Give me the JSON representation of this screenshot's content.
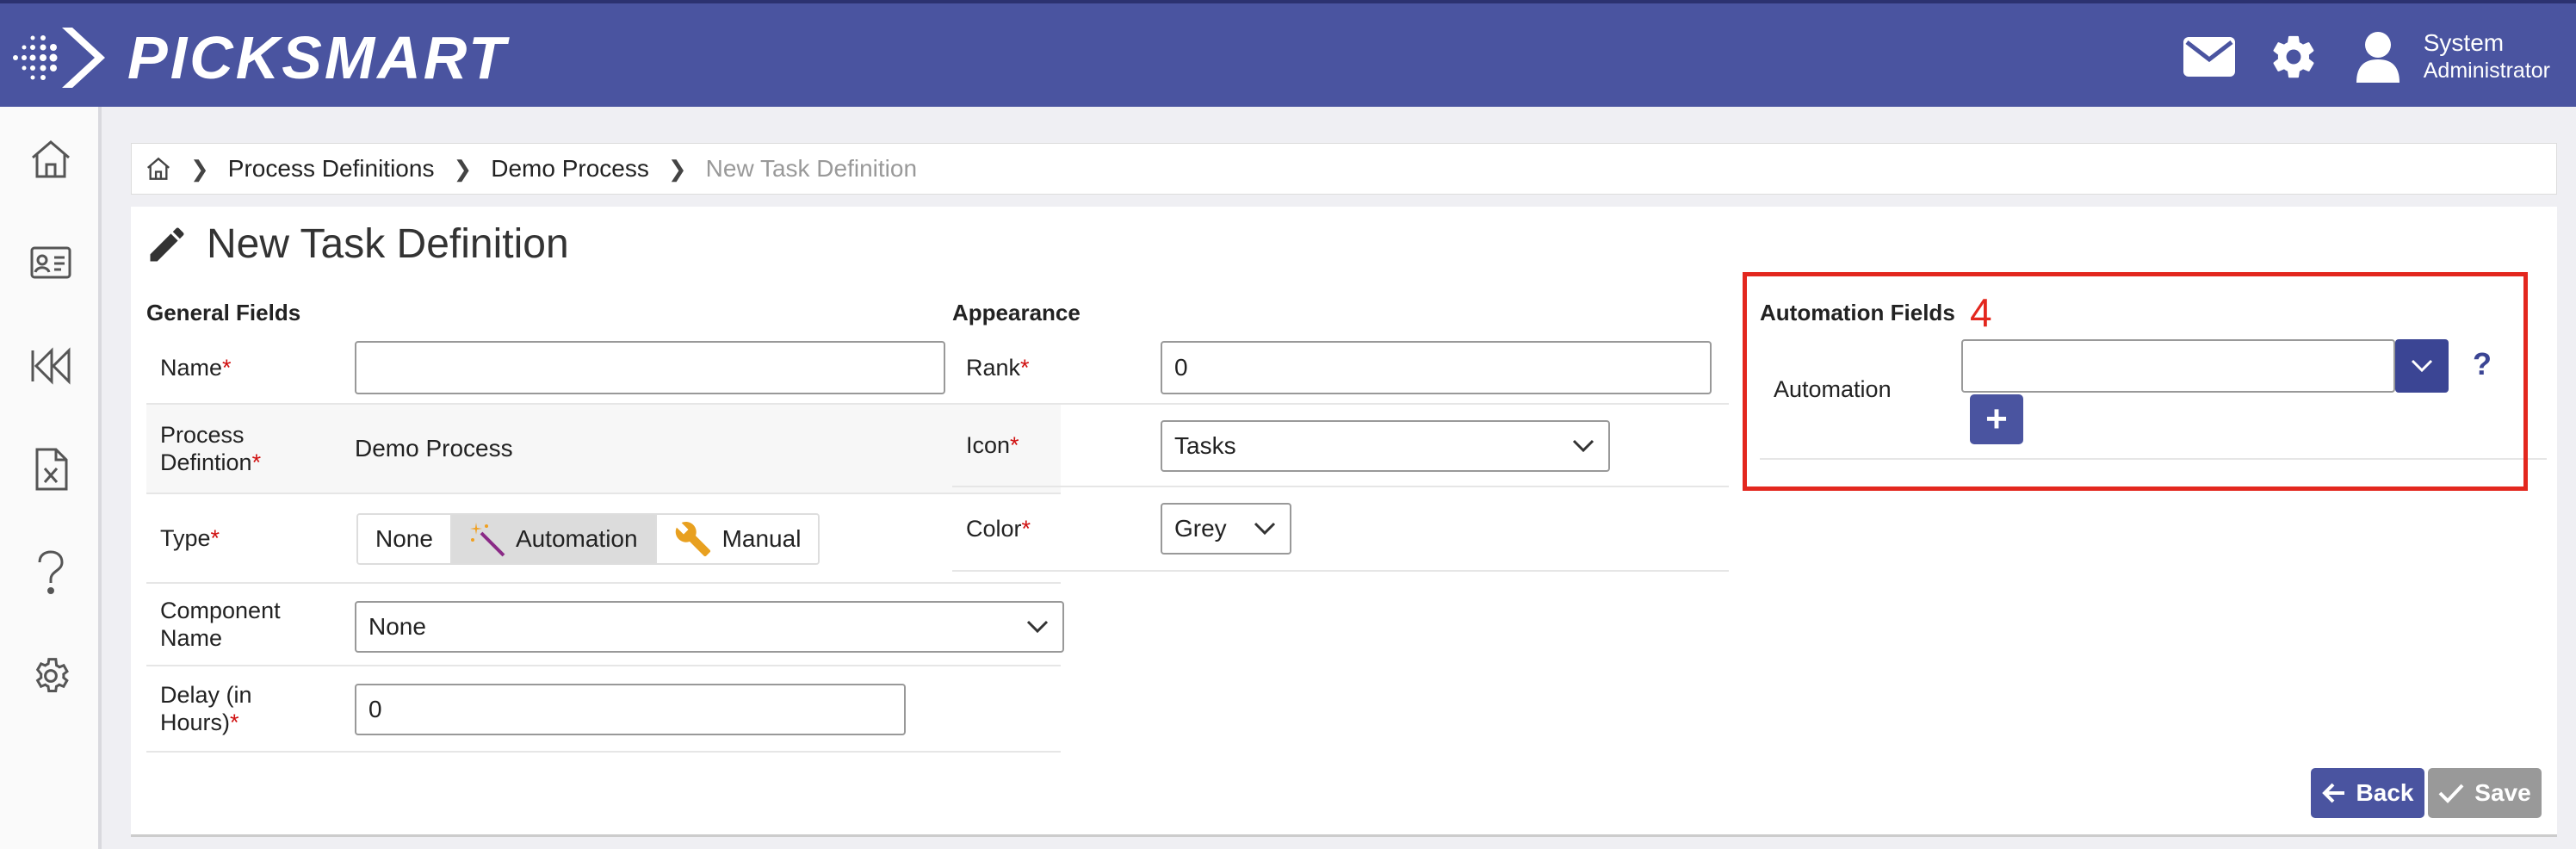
{
  "app": {
    "brand": "PICKSMART",
    "accent": "#4a54a0",
    "accent_dark": "#3b4594"
  },
  "header": {
    "user_name": "System",
    "user_role": "Administrator",
    "icons": [
      "envelope-icon",
      "gear-icon",
      "user-icon"
    ]
  },
  "sidebar": {
    "items": [
      "home-icon",
      "id-card-icon",
      "rewind-icon",
      "excel-file-icon",
      "question-icon",
      "settings-icon"
    ]
  },
  "breadcrumb": {
    "items": [
      "Process Definitions",
      "Demo Process"
    ],
    "current": "New Task Definition"
  },
  "page": {
    "title": "New Task Definition"
  },
  "general": {
    "heading": "General Fields",
    "name_label": "Name",
    "name_value": "",
    "process_label_1": "Process",
    "process_label_2": "Defintion",
    "process_value": "Demo Process",
    "type_label": "Type",
    "type_options": [
      "None",
      "Automation",
      "Manual"
    ],
    "type_selected": "Automation",
    "component_label_1": "Component",
    "component_label_2": "Name",
    "component_value": "None",
    "delay_label_1": "Delay (in",
    "delay_label_2": "Hours)",
    "delay_value": "0"
  },
  "appearance": {
    "heading": "Appearance",
    "rank_label": "Rank",
    "rank_value": "0",
    "icon_label": "Icon",
    "icon_value": "Tasks",
    "color_label": "Color",
    "color_value": "Grey"
  },
  "automation": {
    "heading": "Automation Fields",
    "label": "Automation",
    "value": "",
    "help": "?",
    "add": "+"
  },
  "annotation": {
    "number": "4",
    "color": "#e3271e"
  },
  "actions": {
    "back": "Back",
    "save": "Save"
  },
  "required_mark": "*"
}
